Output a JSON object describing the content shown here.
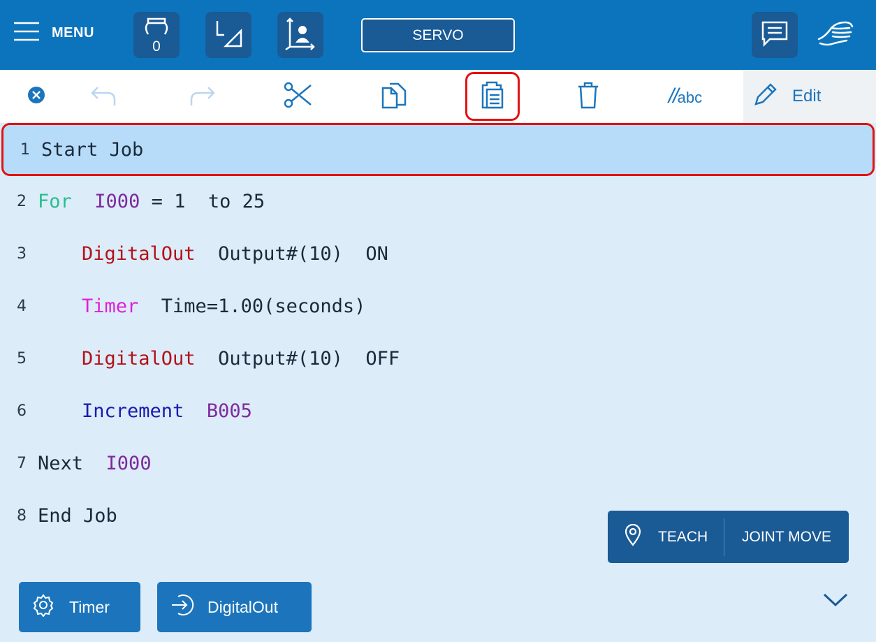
{
  "topbar": {
    "menu_label": "MENU",
    "tool_number": "0",
    "servo_label": "SERVO"
  },
  "toolbar": {
    "comment_label": "abc",
    "comment_prefix": "//",
    "edit_label": "Edit"
  },
  "program": {
    "lines": [
      {
        "num": "1",
        "text": "Start Job"
      },
      {
        "num": "2",
        "for_kw": "For",
        "var": "I000",
        "rest": " = 1  to 25"
      },
      {
        "num": "3",
        "cmd": "DigitalOut",
        "args": "  Output#(10)  ON"
      },
      {
        "num": "4",
        "cmd": "Timer",
        "args": "  Time=1.00(seconds)"
      },
      {
        "num": "5",
        "cmd": "DigitalOut",
        "args": "  Output#(10)  OFF"
      },
      {
        "num": "6",
        "cmd": "Increment",
        "var": "B005"
      },
      {
        "num": "7",
        "text": "Next",
        "var": "I000"
      },
      {
        "num": "8",
        "text": "End Job"
      }
    ]
  },
  "bottom": {
    "teach_label": "TEACH",
    "joint_move_label": "JOINT MOVE",
    "quick_timer_label": "Timer",
    "quick_dout_label": "DigitalOut"
  },
  "colors": {
    "topbar": "#0c74bd",
    "dark_button": "#1a5a95",
    "highlight": "#e31212",
    "selected_row": "#b7dcfa",
    "background": "#dcecf8"
  }
}
